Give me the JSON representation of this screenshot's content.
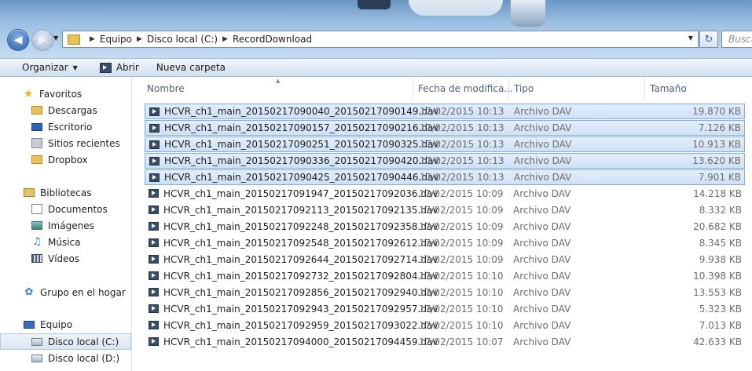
{
  "address": {
    "crumbs": [
      "Equipo",
      "Disco local (C:)",
      "RecordDownload"
    ],
    "search_placeholder": "Busca"
  },
  "toolbar": {
    "organize": "Organizar",
    "open": "Abrir",
    "new_folder": "Nueva carpeta"
  },
  "sidebar": {
    "favorites": {
      "header": "Favoritos",
      "items": [
        "Descargas",
        "Escritorio",
        "Sitios recientes",
        "Dropbox"
      ]
    },
    "libraries": {
      "header": "Bibliotecas",
      "items": [
        "Documentos",
        "Imágenes",
        "Música",
        "Vídeos"
      ]
    },
    "homegroup": "Grupo en el hogar",
    "computer": {
      "header": "Equipo",
      "items": [
        "Disco local (C:)",
        "Disco local (D:)"
      ],
      "selected": "Disco local (C:)"
    }
  },
  "columns": {
    "name": "Nombre",
    "date": "Fecha de modifica...",
    "type": "Tipo",
    "size": "Tamaño"
  },
  "files": [
    {
      "name": "HCVR_ch1_main_20150217090040_20150217090149.dav",
      "date": "17/02/2015 10:13",
      "type": "Archivo DAV",
      "size": "19.870 KB",
      "selected": true
    },
    {
      "name": "HCVR_ch1_main_20150217090157_20150217090216.dav",
      "date": "17/02/2015 10:13",
      "type": "Archivo DAV",
      "size": "7.126 KB",
      "selected": true
    },
    {
      "name": "HCVR_ch1_main_20150217090251_20150217090325.dav",
      "date": "17/02/2015 10:13",
      "type": "Archivo DAV",
      "size": "10.913 KB",
      "selected": true
    },
    {
      "name": "HCVR_ch1_main_20150217090336_20150217090420.dav",
      "date": "17/02/2015 10:13",
      "type": "Archivo DAV",
      "size": "13.620 KB",
      "selected": true
    },
    {
      "name": "HCVR_ch1_main_20150217090425_20150217090446.dav",
      "date": "17/02/2015 10:13",
      "type": "Archivo DAV",
      "size": "7.901 KB",
      "selected": true
    },
    {
      "name": "HCVR_ch1_main_20150217091947_20150217092036.dav",
      "date": "17/02/2015 10:09",
      "type": "Archivo DAV",
      "size": "14.218 KB",
      "selected": false
    },
    {
      "name": "HCVR_ch1_main_20150217092113_20150217092135.dav",
      "date": "17/02/2015 10:09",
      "type": "Archivo DAV",
      "size": "8.332 KB",
      "selected": false
    },
    {
      "name": "HCVR_ch1_main_20150217092248_20150217092358.dav",
      "date": "17/02/2015 10:09",
      "type": "Archivo DAV",
      "size": "20.682 KB",
      "selected": false
    },
    {
      "name": "HCVR_ch1_main_20150217092548_20150217092612.dav",
      "date": "17/02/2015 10:09",
      "type": "Archivo DAV",
      "size": "8.345 KB",
      "selected": false
    },
    {
      "name": "HCVR_ch1_main_20150217092644_20150217092714.dav",
      "date": "17/02/2015 10:09",
      "type": "Archivo DAV",
      "size": "9.938 KB",
      "selected": false
    },
    {
      "name": "HCVR_ch1_main_20150217092732_20150217092804.dav",
      "date": "17/02/2015 10:10",
      "type": "Archivo DAV",
      "size": "10.398 KB",
      "selected": false
    },
    {
      "name": "HCVR_ch1_main_20150217092856_20150217092940.dav",
      "date": "17/02/2015 10:10",
      "type": "Archivo DAV",
      "size": "13.553 KB",
      "selected": false
    },
    {
      "name": "HCVR_ch1_main_20150217092943_20150217092957.dav",
      "date": "17/02/2015 10:10",
      "type": "Archivo DAV",
      "size": "5.323 KB",
      "selected": false
    },
    {
      "name": "HCVR_ch1_main_20150217092959_20150217093022.dav",
      "date": "17/02/2015 10:10",
      "type": "Archivo DAV",
      "size": "7.013 KB",
      "selected": false
    },
    {
      "name": "HCVR_ch1_main_20150217094000_20150217094459.dav",
      "date": "17/02/2015 10:07",
      "type": "Archivo DAV",
      "size": "42.633 KB",
      "selected": false
    }
  ]
}
